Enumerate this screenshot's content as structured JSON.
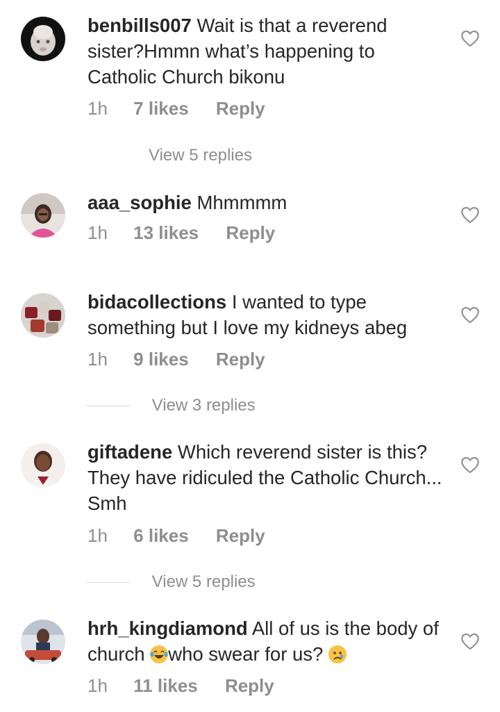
{
  "comments": [
    {
      "username": "benbills007",
      "text_lines": [
        "Wait is that a reverend",
        "sister?Hmmn what’s happening to",
        "Catholic Church bikonu"
      ],
      "time": "1h",
      "likes": "7 likes",
      "reply_label": "Reply",
      "view_replies": "View 5 replies",
      "show_line": false
    },
    {
      "username": "aaa_sophie",
      "text_lines": [
        "Mhmmmm"
      ],
      "time": "1h",
      "likes": "13 likes",
      "reply_label": "Reply"
    },
    {
      "username": "bidacollections",
      "text_lines": [
        "I wanted to type",
        "something but I love my kidneys abeg"
      ],
      "time": "1h",
      "likes": "9 likes",
      "reply_label": "Reply",
      "view_replies": "View 3 replies",
      "show_line": true
    },
    {
      "username": "giftadene",
      "text_lines": [
        "Which reverend sister is this?",
        "They have ridiculed the Catholic Church...",
        "Smh"
      ],
      "time": "1h",
      "likes": "6 likes",
      "reply_label": "Reply",
      "view_replies": "View 5 replies",
      "show_line": true
    },
    {
      "username": "hrh_kingdiamond",
      "text_lines": [
        "All of us is the body of",
        "church",
        "who swear for us?"
      ],
      "time": "1h",
      "likes": "11 likes",
      "reply_label": "Reply"
    }
  ],
  "icons": {
    "like": "heart-outline-icon",
    "emoji_1": "tears-of-joy-emoji",
    "emoji_2": "crying-face-emoji"
  },
  "colors": {
    "text": "#262626",
    "meta": "#8e8e8e",
    "divider": "#dbdbdb"
  }
}
